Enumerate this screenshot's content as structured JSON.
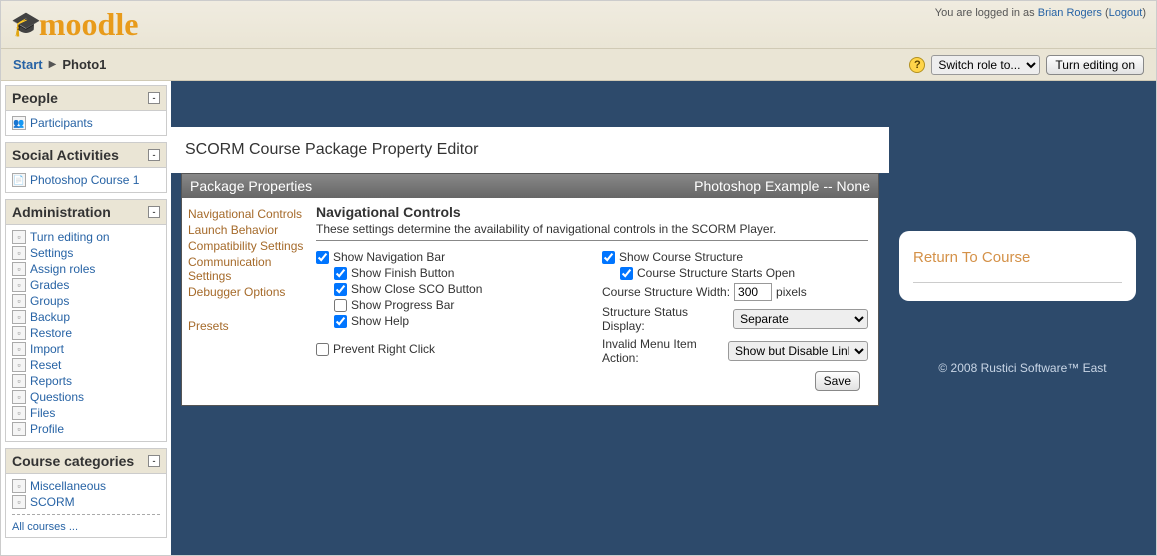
{
  "logo_text": "moodle",
  "login": {
    "prefix": "You are logged in as ",
    "user": "Brian Rogers",
    "logout": "Logout"
  },
  "breadcrumb": {
    "start": "Start",
    "current": "Photo1"
  },
  "controls": {
    "switch_role": "Switch role to...",
    "turn_editing": "Turn editing on"
  },
  "blocks": {
    "people": {
      "title": "People",
      "participants": "Participants"
    },
    "social": {
      "title": "Social Activities",
      "items": [
        "Photoshop Course 1"
      ]
    },
    "admin": {
      "title": "Administration",
      "items": [
        "Turn editing on",
        "Settings",
        "Assign roles",
        "Grades",
        "Groups",
        "Backup",
        "Restore",
        "Import",
        "Reset",
        "Reports",
        "Questions",
        "Files",
        "Profile"
      ]
    },
    "categories": {
      "title": "Course categories",
      "items": [
        "Miscellaneous",
        "SCORM"
      ],
      "all": "All courses ..."
    }
  },
  "editor": {
    "title": "SCORM Course Package Property Editor",
    "panel_title": "Package Properties",
    "panel_subtitle": "Photoshop Example -- None",
    "nav": [
      "Navigational Controls",
      "Launch Behavior",
      "Compatibility Settings",
      "Communication Settings",
      "Debugger Options"
    ],
    "presets": "Presets",
    "section_heading": "Navigational Controls",
    "section_desc": "These settings determine the availability of navigational controls in the SCORM Player.",
    "left_opts": {
      "navbar": "Show Navigation Bar",
      "finish": "Show Finish Button",
      "close": "Show Close SCO Button",
      "progress": "Show Progress Bar",
      "help": "Show Help",
      "prevent": "Prevent Right Click"
    },
    "right_opts": {
      "structure": "Show Course Structure",
      "starts_open": "Course Structure Starts Open",
      "width_label": "Course Structure Width:",
      "width_value": "300",
      "pixels": "pixels",
      "status_label": "Structure Status Display:",
      "status_value": "Separate",
      "invalid_label": "Invalid Menu Item Action:",
      "invalid_value": "Show but Disable Link"
    },
    "save": "Save"
  },
  "return_link": "Return To Course",
  "footer": "© 2008 Rustici Software™ East"
}
